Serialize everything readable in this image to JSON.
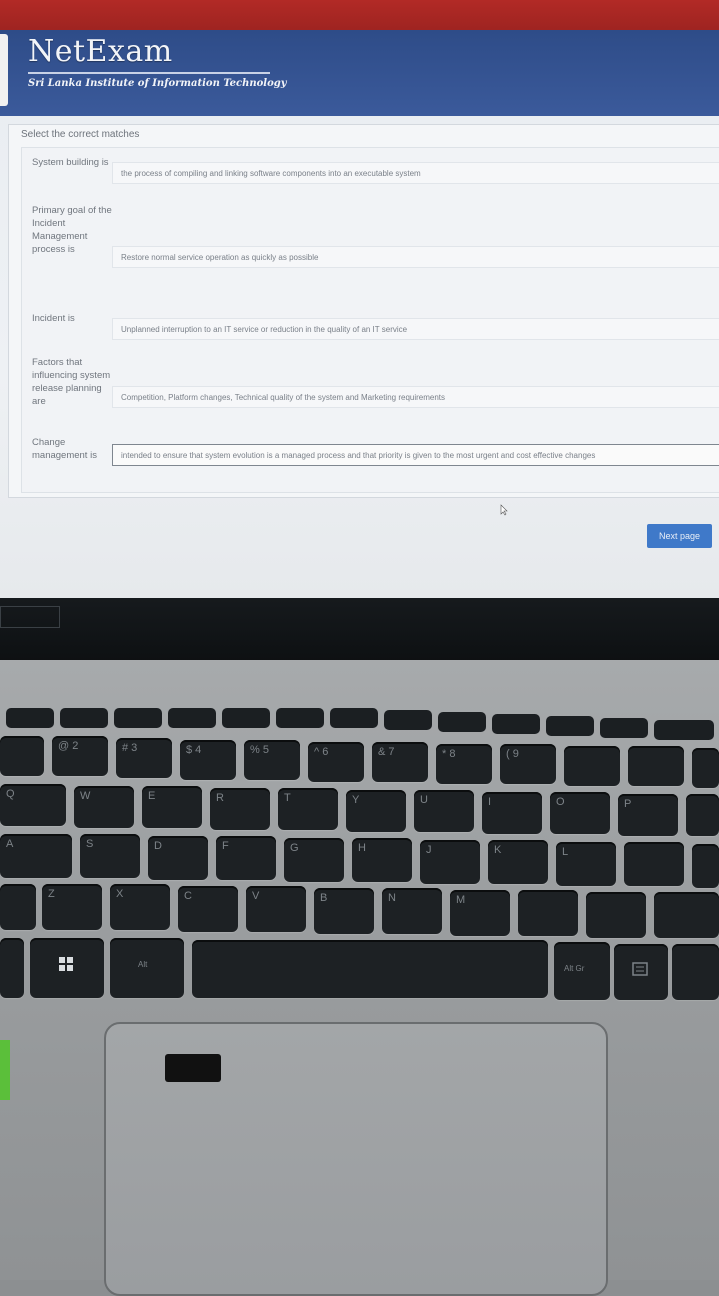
{
  "header": {
    "logo_title": "NetExam",
    "logo_subtitle": "Sri Lanka Institute of Information Technology"
  },
  "quiz": {
    "instruction": "Select the correct matches",
    "items": [
      {
        "label": "System building is",
        "answer": "the process of compiling and linking software components into an executable system"
      },
      {
        "label": "Primary goal of the Incident Management process is",
        "answer": "Restore normal service operation as quickly as possible"
      },
      {
        "label": "Incident is",
        "answer": "Unplanned interruption to an IT service or reduction in the quality of an IT service"
      },
      {
        "label": "Factors that influencing system release planning are",
        "answer": "Competition, Platform changes, Technical quality of the system and Marketing requirements"
      },
      {
        "label": "Change management is",
        "answer": "intended to ensure that system evolution is a managed process and that priority is given to the most urgent and cost effective changes"
      }
    ],
    "next_button": "Next page"
  },
  "colors": {
    "header_blue": "#3b5a9b",
    "button_blue": "#3f79c9",
    "bezel_red": "#a8272a"
  },
  "keyboard": {
    "row_numbers": [
      "@ 2",
      "# 3",
      "$ 4",
      "% 5",
      "^ 6",
      "& 7",
      "* 8",
      "( 9"
    ],
    "row_qwerty": [
      "Q",
      "W",
      "E",
      "R",
      "T",
      "Y",
      "U",
      "I",
      "O",
      "P"
    ],
    "row_asdf": [
      "A",
      "S",
      "D",
      "F",
      "G",
      "H",
      "J",
      "K",
      "L"
    ],
    "row_zxcv": [
      "Z",
      "X",
      "C",
      "V",
      "B",
      "N",
      "M"
    ],
    "alt_left": "Alt",
    "alt_right": "Alt Gr",
    "win_icon": "windows-logo-icon"
  }
}
